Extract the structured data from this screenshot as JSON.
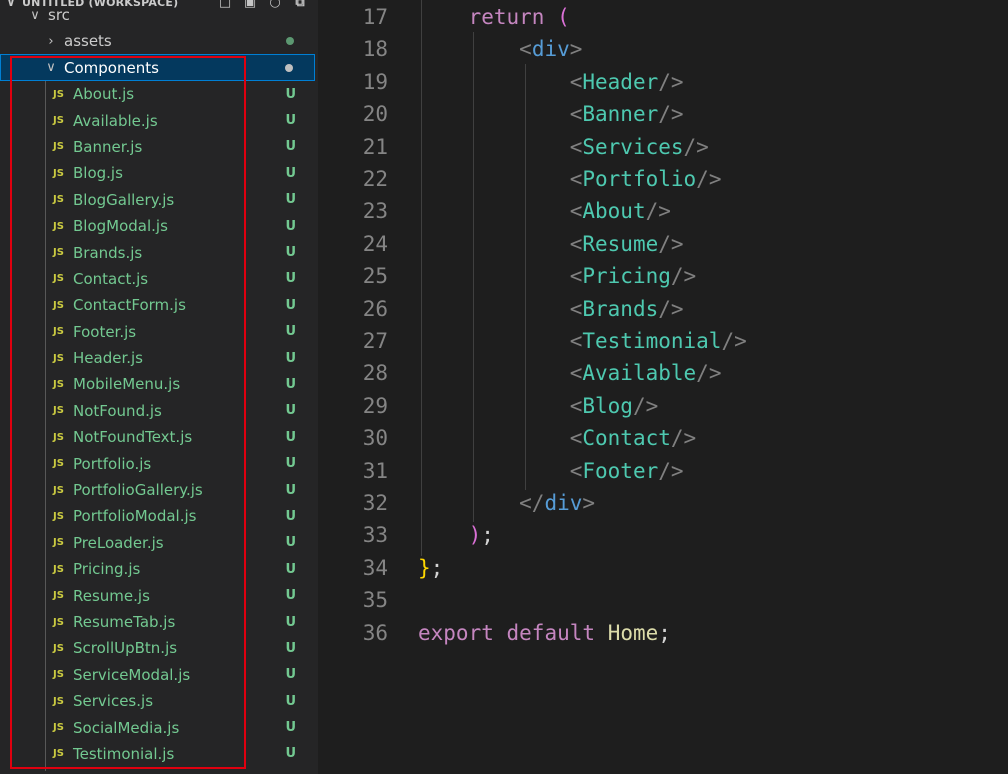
{
  "sidebar": {
    "workspace_title": "UNTITLED (WORKSPACE)",
    "src_label": "src",
    "assets_label": "assets",
    "components_label": "Components",
    "file_icon_text": "JS",
    "untracked_badge": "U",
    "files": [
      "About.js",
      "Available.js",
      "Banner.js",
      "Blog.js",
      "BlogGallery.js",
      "BlogModal.js",
      "Brands.js",
      "Contact.js",
      "ContactForm.js",
      "Footer.js",
      "Header.js",
      "MobileMenu.js",
      "NotFound.js",
      "NotFoundText.js",
      "Portfolio.js",
      "PortfolioGallery.js",
      "PortfolioModal.js",
      "PreLoader.js",
      "Pricing.js",
      "Resume.js",
      "ResumeTab.js",
      "ScrollUpBtn.js",
      "ServiceModal.js",
      "Services.js",
      "SocialMedia.js",
      "Testimonial.js"
    ]
  },
  "editor": {
    "return_keyword": "return",
    "open_paren": "(",
    "close_paren": ")",
    "semicolon": ";",
    "div_tag": "div",
    "closing_brace": "}",
    "export_kw": "export",
    "default_kw": "default",
    "home_ident": "Home",
    "components": [
      "Header",
      "Banner",
      "Services",
      "Portfolio",
      "About",
      "Resume",
      "Pricing",
      "Brands",
      "Testimonial",
      "Available",
      "Blog",
      "Contact",
      "Footer"
    ],
    "line_numbers": [
      "17",
      "18",
      "19",
      "20",
      "21",
      "22",
      "23",
      "24",
      "25",
      "26",
      "27",
      "28",
      "29",
      "30",
      "31",
      "32",
      "33",
      "34",
      "35",
      "36"
    ]
  },
  "colors": {
    "highlight_box": "#e0000f",
    "untracked_green": "#73c991",
    "js_icon_yellow": "#cbcb41",
    "selected_row": "#04395e"
  }
}
